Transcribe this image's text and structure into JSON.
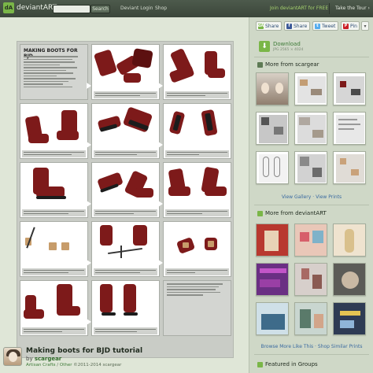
{
  "topbar": {
    "logo_text": "deviantART",
    "logo_mark": "dA",
    "search_button": "Search",
    "nav_links": [
      "Deviant Login",
      "Shop"
    ],
    "join_link": "Join deviantART for FREE",
    "tour_link": "Take the Tour"
  },
  "tutorial_sheet": {
    "title": "MAKING BOOTS FOR BJD"
  },
  "deviation": {
    "title": "Making boots for BJD tutorial",
    "by_label": "by",
    "author": "scargear",
    "category_1": "Artisan Crafts",
    "category_sep": "/",
    "category_2": "Other",
    "copyright": "©2011-2014 scargear"
  },
  "sidebar": {
    "share_buttons": [
      {
        "label": "Share",
        "icon": "dA"
      },
      {
        "label": "Share",
        "icon": "f"
      },
      {
        "label": "Tweet",
        "icon": "t"
      },
      {
        "label": "Pin",
        "icon": "P"
      }
    ],
    "download_label": "Download",
    "download_size": "JPG 2565 × 4024",
    "more_from_artist_title": "More from scargear",
    "view_gallery": "View Gallery",
    "view_sep": "·",
    "view_prints": "View Prints",
    "more_from_site_title": "More from deviantART",
    "browse_more": "Browse More Like This",
    "shop_prints": "Shop Similar Prints",
    "featured_groups_title": "Featured in Groups"
  },
  "colors": {
    "accent_green": "#7ab648",
    "topbar": "#3b463a",
    "page_bg": "#dfe6d7",
    "boot_red": "#7d1a1a"
  }
}
